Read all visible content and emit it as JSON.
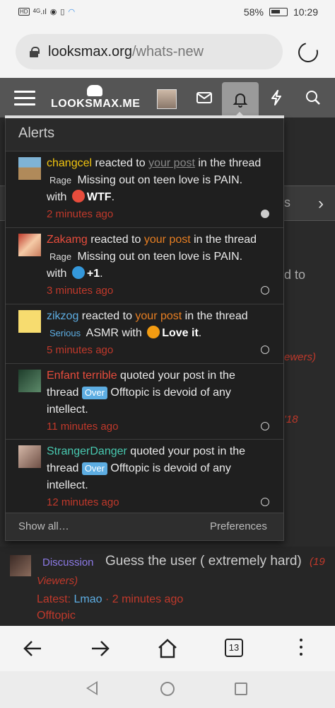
{
  "status_bar": {
    "left_icons": [
      "hd-icon",
      "signal-4g-icon",
      "eye-icon",
      "vibrate-icon",
      "sync-icon"
    ],
    "network": "4G",
    "battery": "58%",
    "time": "10:29"
  },
  "browser": {
    "url_host": "looksmax.org",
    "url_path": "/whats-new",
    "tabs_count": "13"
  },
  "site": {
    "logo": "LOOKSMAX.ME",
    "header_icons": [
      "inbox-icon",
      "bell-icon",
      "lightning-icon",
      "search-icon"
    ]
  },
  "alerts": {
    "title": "Alerts",
    "show_all": "Show all…",
    "preferences": "Preferences",
    "items": [
      {
        "user": "changcel",
        "action": " reacted to ",
        "link": "your post",
        "rest": " in the thread ",
        "prefix": "Rage",
        "thread": " Missing out on teen love is PAIN.",
        "with": " with ",
        "reaction": "WTF",
        "end": ".",
        "time": "2 minutes ago",
        "read": false
      },
      {
        "user": "Zakamg",
        "action": " reacted to ",
        "link": "your post",
        "rest": " in the thread ",
        "prefix": "Rage",
        "thread": " Missing out on teen love is PAIN.",
        "with": " with ",
        "reaction": "+1",
        "end": ".",
        "time": "3 minutes ago",
        "read": true
      },
      {
        "user": "zikzog",
        "action": " reacted to ",
        "link": "your post",
        "rest": " in the thread ",
        "prefix": "Serious",
        "thread": " ASMR",
        "with": " with ",
        "reaction": "Love it",
        "end": ".",
        "time": "5 minutes ago",
        "read": true
      },
      {
        "user": "Enfant terrible",
        "action": " quoted your post in the thread ",
        "prefix": "Over",
        "thread": " Offtopic is devoid of any intellect.",
        "time": "11 minutes ago",
        "read": true
      },
      {
        "user": "StrangerDanger",
        "action": " quoted your post in the thread ",
        "prefix": "Over",
        "thread": " Offtopic is devoid of any intellect.",
        "time": "12 minutes ago",
        "read": true
      }
    ]
  },
  "background_page": {
    "tab_fragment": "s",
    "fragment_to": "d to",
    "fragment_viewers": "ewers)",
    "fragment_18": "'18",
    "discussion": {
      "prefix": "Discussion",
      "title": "Guess the user ( extremely hard)",
      "viewers_a": "(19",
      "viewers_b": "Viewers)",
      "latest_label": "Latest: ",
      "latest_user": "Lmao",
      "latest_time": " · 2 minutes ago",
      "forum": "Offtopic"
    }
  },
  "colors": {
    "accent_red": "#c0392b",
    "link_blue": "#5dade2",
    "header_bg": "#555555",
    "dropdown_bg": "#1f1f1f"
  }
}
